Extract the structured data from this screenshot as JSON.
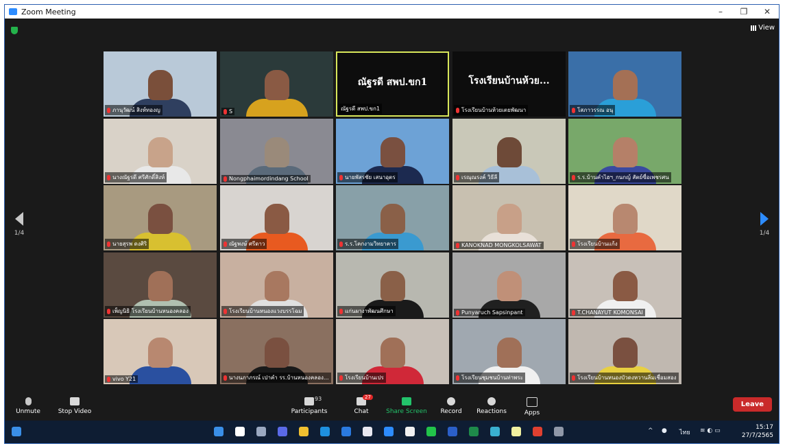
{
  "window": {
    "title": "Zoom Meeting",
    "minimize": "–",
    "maximize": "❐",
    "close": "✕"
  },
  "header": {
    "view_label": "View"
  },
  "nav": {
    "left_page": "1/4",
    "right_page": "1/4"
  },
  "tiles": [
    {
      "name": "ภานุวัฒน์ สิงห์ทองญ",
      "muted": true,
      "bg": "#b9c9d8",
      "skin": "#7a4f3a",
      "shirt": "#2f3f5f"
    },
    {
      "name": "S",
      "muted": true,
      "bg": "#2b3a3a",
      "skin": "#8a5a44",
      "shirt": "#d7a21e"
    },
    {
      "name": "ณัฐรดี สพป.ขก1",
      "muted": false,
      "bg": "#0d0d0d",
      "display": "ณัฐรดี สพป.ขก1",
      "active": true
    },
    {
      "name": "โรงเรียนบ้านห้วยเตยพัฒนา",
      "muted": true,
      "bg": "#0d0d0d",
      "display": "โรงเรียนบ้านห้วย..."
    },
    {
      "name": "โสภาวรรณ อนุ",
      "muted": true,
      "bg": "#3a6fa8",
      "skin": "#a47055",
      "shirt": "#2a9fd8"
    },
    {
      "name": "นางณัฐรดี ศรีศักดิ์สิงห์",
      "muted": true,
      "bg": "#d9d2c8",
      "skin": "#c8a38a",
      "shirt": "#e8e8e8"
    },
    {
      "name": "Nongphaimordindang School",
      "muted": true,
      "bg": "#8a8a92",
      "skin": "#9a8a7a",
      "shirt": "#5a6a7a"
    },
    {
      "name": "นายพัสรชัย เสนาอุตร",
      "muted": true,
      "bg": "#6da2d6",
      "skin": "#7a5040",
      "shirt": "#1c2a50"
    },
    {
      "name": "เรณุณรงค์ วิธีลี",
      "muted": true,
      "bg": "#c9c8b8",
      "skin": "#6e4a38",
      "shirt": "#a8c0d8"
    },
    {
      "name": "ร.ร.บ้านคำไฮฯ_กนกญ์ สัตย์ซื่อเพชรศน",
      "muted": true,
      "bg": "#78a86a",
      "skin": "#b58068",
      "shirt": "#3a4aa0"
    },
    {
      "name": "นายสุรพ ดงศิริ",
      "muted": true,
      "bg": "#a89a80",
      "skin": "#7a5040",
      "shirt": "#d8c030"
    },
    {
      "name": "ณัฐพงษ์ ศรีดาว",
      "muted": true,
      "bg": "#d8d4d0",
      "skin": "#8a5a44",
      "shirt": "#e85a20"
    },
    {
      "name": "ร.ร.โคกงามวิทยาคาร",
      "muted": true,
      "bg": "#88a0a8",
      "skin": "#8a6048",
      "shirt": "#3a9ad0"
    },
    {
      "name": "KANOKNAD MONGKOLSAWAT",
      "muted": true,
      "bg": "#c8c0b0",
      "skin": "#c8a088",
      "shirt": "#e8e0d8"
    },
    {
      "name": "โรงเรียนบ้านแก้ง",
      "muted": true,
      "bg": "#e0d8c8",
      "skin": "#b88870",
      "shirt": "#e86a40"
    },
    {
      "name": "เพ็ญนิธิ โรงเรียนบ้านหนองคลอง",
      "muted": true,
      "bg": "#5a4a40",
      "skin": "#a07058",
      "shirt": "#b0c0b0"
    },
    {
      "name": "โรงเรียนบ้านหนองแวงบรรโฉม",
      "muted": true,
      "bg": "#c8b0a0",
      "skin": "#a87860",
      "shirt": "#e0e0e0"
    },
    {
      "name": "แก่นผางาพัฒนศึกษา",
      "muted": true,
      "bg": "#b8b8b0",
      "skin": "#8a6048",
      "shirt": "#1a1a1a"
    },
    {
      "name": "Punyaruch Sapsinpant",
      "muted": true,
      "bg": "#a8a8a8",
      "skin": "#c09078",
      "shirt": "#202020"
    },
    {
      "name": "T.CHANAYUT KOMONSAI",
      "muted": true,
      "bg": "#c8c0b8",
      "skin": "#8a5a44",
      "shirt": "#f0f0f0"
    },
    {
      "name": "vivo Y21",
      "muted": true,
      "bg": "#d8c8b8",
      "skin": "#b88870",
      "shirt": "#2a50a0"
    },
    {
      "name": "นางนภาภรณ์ เปาคำ รร.บ้านหนองคลอง...",
      "muted": true,
      "bg": "#8a7060",
      "skin": "#7a5040",
      "shirt": "#1a1a1a"
    },
    {
      "name": "โรงเรียนบ้านเปร",
      "muted": true,
      "bg": "#c8c0b8",
      "skin": "#a07058",
      "shirt": "#d02838"
    },
    {
      "name": "โรงเรียนชุมชนบ้านท่าพระ",
      "muted": true,
      "bg": "#a0a8b0",
      "skin": "#a07058",
      "shirt": "#f0f0f0"
    },
    {
      "name": "โรงเรียนบ้านหนองบัวดงหวานลิ่มเชื่อมสอง",
      "muted": true,
      "bg": "#c0b8b0",
      "skin": "#7a5040",
      "shirt": "#e8d040"
    }
  ],
  "toolbar": {
    "unmute": "Unmute",
    "stop_video": "Stop Video",
    "participants": "Participants",
    "participants_count": "93",
    "chat": "Chat",
    "chat_badge": "27",
    "share": "Share Screen",
    "record": "Record",
    "reactions": "Reactions",
    "apps": "Apps",
    "leave": "Leave"
  },
  "taskbar": {
    "lang": "ไทย",
    "time": "15:17",
    "date": "27/7/2565",
    "icons": [
      "start-icon",
      "search-icon",
      "task-view-icon",
      "chat-icon",
      "file-explorer-icon",
      "edge-icon",
      "mail-icon",
      "store-icon",
      "zoom-icon",
      "app-icon",
      "line-icon",
      "word-icon",
      "excel-icon",
      "app2-icon",
      "notes-icon",
      "chrome-icon",
      "calculator-icon"
    ],
    "icon_colors": [
      "#3a8fe8",
      "#ffffff",
      "#9aa8c0",
      "#5a6ae8",
      "#f0c030",
      "#1e90e0",
      "#2a7ae0",
      "#e8e8f0",
      "#2d8cff",
      "#f0f0f0",
      "#22c34a",
      "#2b5fc8",
      "#1e8a4a",
      "#3ab0d0",
      "#f0f0a0",
      "#e04030",
      "#9098a8"
    ]
  }
}
